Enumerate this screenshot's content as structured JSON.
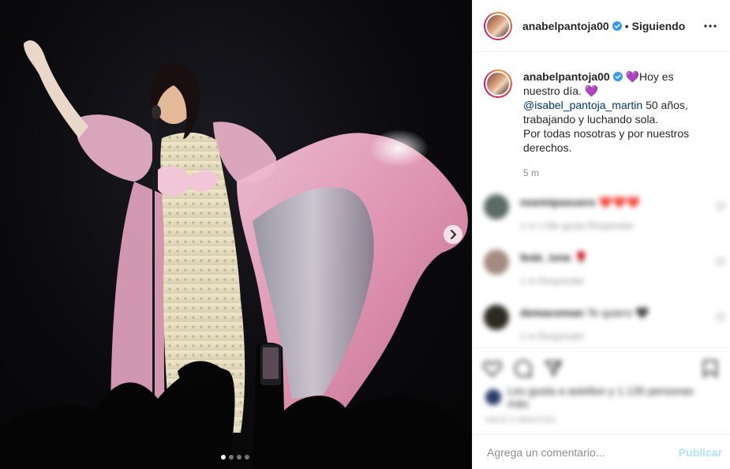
{
  "post": {
    "username": "anabelpantoja00",
    "follow_status": "Siguiendo",
    "separator": "•",
    "carousel": {
      "slide_count": 4,
      "active_index": 0
    }
  },
  "caption": {
    "username": "anabelpantoja00",
    "line1": "💜Hoy es nuestro día. 💜",
    "mention": "@isabel_pantoja_martin",
    "line2": " 50 años, trabajando y luchando sola.",
    "line3": "Por todas nosotras y por nuestros derechos.",
    "time": "5 m"
  },
  "comments": [
    {
      "username": "noemipasuero",
      "text": "❤️❤️❤️",
      "meta": "1 m   1 Me gusta   Responder"
    },
    {
      "username": "fede_ivne",
      "text": "🌹",
      "meta": "1 m   Responder"
    },
    {
      "username": "demaceman",
      "text": "Te quiero 🖤",
      "meta": "1 m   Responder"
    }
  ],
  "likes_text": "Les gusta a astellon y 1.135 personas más",
  "date_text": "HACE 5 MINUTOS",
  "add_comment": {
    "placeholder": "Agrega un comentario...",
    "publish_label": "Publicar"
  },
  "icons": {
    "verified": "verified-badge-icon",
    "more": "more-options-icon",
    "next": "chevron-right-icon",
    "like": "heart-icon",
    "comment": "comment-icon",
    "share": "share-icon",
    "save": "bookmark-icon"
  },
  "colors": {
    "verified": "#3897f0",
    "mention": "#00376b",
    "muted": "#8e8e8e",
    "publish": "#b2dffc"
  }
}
